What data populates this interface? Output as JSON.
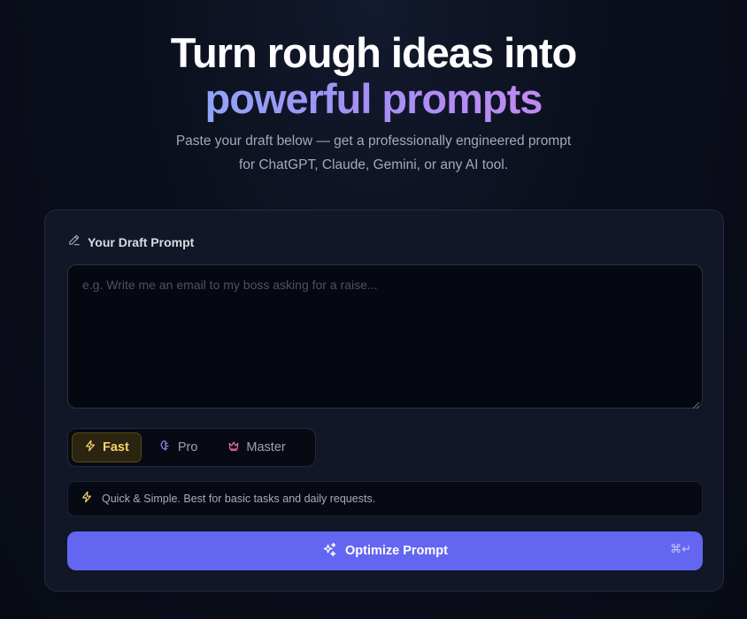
{
  "hero": {
    "title_line1": "Turn rough ideas into",
    "title_line2": "powerful prompts",
    "subtitle_line1": "Paste your draft below — get a professionally engineered prompt",
    "subtitle_line2": "for ChatGPT, Claude, Gemini, or any AI tool."
  },
  "draft": {
    "label": "Your Draft Prompt",
    "icon": "pencil-icon",
    "value": "",
    "placeholder": "e.g. Write me an email to my boss asking for a raise..."
  },
  "modes": {
    "items": [
      {
        "label": "Fast",
        "icon": "lightning-icon",
        "active": true,
        "color": "#f5d36b"
      },
      {
        "label": "Pro",
        "icon": "brain-icon",
        "active": false,
        "color": "#8b8ff5"
      },
      {
        "label": "Master",
        "icon": "crown-icon",
        "active": false,
        "color": "#f472b6"
      }
    ]
  },
  "hint": {
    "icon": "lightning-icon",
    "text": "Quick & Simple. Best for basic tasks and daily requests."
  },
  "optimize": {
    "label": "Optimize Prompt",
    "icon": "sparkles-icon",
    "shortcut": "⌘↵"
  },
  "colors": {
    "accent": "#6366f1",
    "active_mode": "#f5d36b",
    "background": "#0b0f1c"
  }
}
